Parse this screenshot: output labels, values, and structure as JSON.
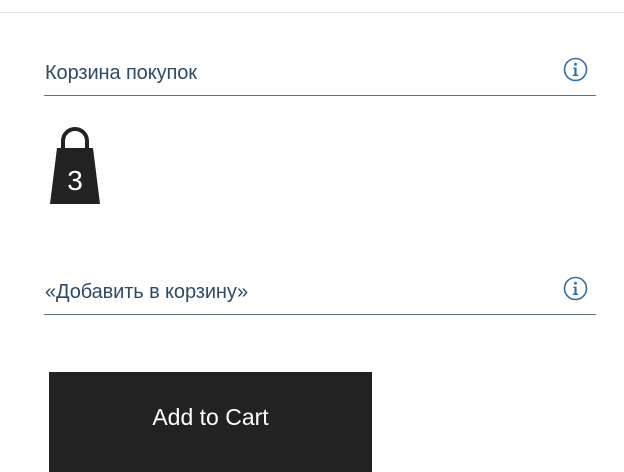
{
  "shopping_cart": {
    "title": "Корзина покупок",
    "info_icon": "info-circle-icon",
    "bag_icon": "shopping-bag-icon",
    "item_count": "3"
  },
  "add_to_cart_section": {
    "title": "«Добавить в корзину»",
    "info_icon": "info-circle-icon",
    "button_label": "Add to Cart"
  },
  "colors": {
    "heading_text": "#2f4b63",
    "info_icon": "#2f6ea8",
    "divider": "#5f7482",
    "bag": "#222222",
    "button_bg": "#222222",
    "button_text": "#ffffff"
  }
}
